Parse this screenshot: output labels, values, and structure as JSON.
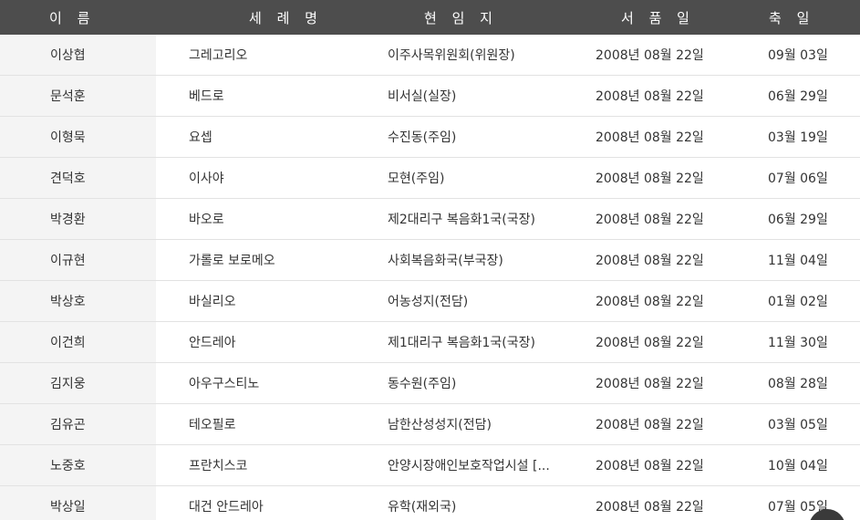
{
  "headers": {
    "name": "이 름",
    "baptismal_name": "세 례 명",
    "assignment": "현 임 지",
    "ordination_date": "서 품 일",
    "feast_day": "축 일"
  },
  "rows": [
    {
      "name": "이상협",
      "baptismal_name": "그레고리오",
      "assignment": "이주사목위원회(위원장)",
      "ordination_date": "2008년 08월 22일",
      "feast_day": "09월 03일"
    },
    {
      "name": "문석훈",
      "baptismal_name": "베드로",
      "assignment": "비서실(실장)",
      "ordination_date": "2008년 08월 22일",
      "feast_day": "06월 29일"
    },
    {
      "name": "이형묵",
      "baptismal_name": "요셉",
      "assignment": "수진동(주임)",
      "ordination_date": "2008년 08월 22일",
      "feast_day": "03월 19일"
    },
    {
      "name": "견덕호",
      "baptismal_name": "이사야",
      "assignment": "모현(주임)",
      "ordination_date": "2008년 08월 22일",
      "feast_day": "07월 06일"
    },
    {
      "name": "박경환",
      "baptismal_name": "바오로",
      "assignment": "제2대리구 복음화1국(국장)",
      "ordination_date": "2008년 08월 22일",
      "feast_day": "06월 29일"
    },
    {
      "name": "이규현",
      "baptismal_name": "가롤로 보로메오",
      "assignment": "사회복음화국(부국장)",
      "ordination_date": "2008년 08월 22일",
      "feast_day": "11월 04일"
    },
    {
      "name": "박상호",
      "baptismal_name": "바실리오",
      "assignment": "어농성지(전담)",
      "ordination_date": "2008년 08월 22일",
      "feast_day": "01월 02일"
    },
    {
      "name": "이건희",
      "baptismal_name": "안드레아",
      "assignment": "제1대리구 복음화1국(국장)",
      "ordination_date": "2008년 08월 22일",
      "feast_day": "11월 30일"
    },
    {
      "name": "김지웅",
      "baptismal_name": "아우구스티노",
      "assignment": "동수원(주임)",
      "ordination_date": "2008년 08월 22일",
      "feast_day": "08월 28일"
    },
    {
      "name": "김유곤",
      "baptismal_name": "테오필로",
      "assignment": "남한산성성지(전담)",
      "ordination_date": "2008년 08월 22일",
      "feast_day": "03월 05일"
    },
    {
      "name": "노중호",
      "baptismal_name": "프란치스코",
      "assignment": "안양시장애인보호작업시설 [...",
      "ordination_date": "2008년 08월 22일",
      "feast_day": "10월 04일"
    },
    {
      "name": "박상일",
      "baptismal_name": "대건 안드레아",
      "assignment": "유학(재외국)",
      "ordination_date": "2008년 08월 22일",
      "feast_day": "07월 05일"
    }
  ]
}
